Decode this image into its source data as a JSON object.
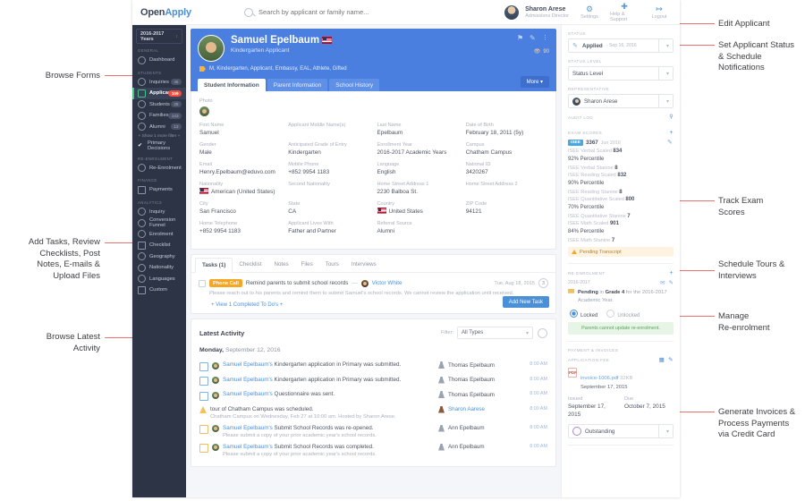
{
  "annotations": {
    "left": [
      {
        "text": "Browse Forms"
      },
      {
        "text": "Add Tasks, Review\nChecklists, Post\nNotes, E-mails &\nUpload Files"
      },
      {
        "text": "Browse Latest\nActivity"
      }
    ],
    "right": [
      {
        "text": "Edit Applicant"
      },
      {
        "text": "Set Applicant Status\n& Schedule\nNotifications"
      },
      {
        "text": "Track Exam\nScores"
      },
      {
        "text": "Schedule Tours &\nInterviews"
      },
      {
        "text": "Manage\nRe-enrolment"
      },
      {
        "text": "Generate Invoices &\nProcess Payments\nvia Credit Card"
      }
    ]
  },
  "topbar": {
    "logo_open": "Open",
    "logo_apply": "Apply",
    "search_placeholder": "Search by applicant or family name...",
    "user_name": "Sharon Arese",
    "user_role": "Admissions Director",
    "actions": [
      {
        "label": "Settings",
        "icon": "gear-icon"
      },
      {
        "label": "Help & Support",
        "icon": "help-icon"
      },
      {
        "label": "Logout",
        "icon": "logout-icon"
      }
    ]
  },
  "sidebar": {
    "year_selector": "2016-2017 Years",
    "groups": [
      {
        "title": "GENERAL",
        "items": [
          {
            "label": "Dashboard",
            "icon": "dashboard-icon",
            "badge": "",
            "active": false
          }
        ]
      },
      {
        "title": "STUDENTS",
        "items": [
          {
            "label": "Inquiries",
            "icon": "inquiries-icon",
            "badge": "45",
            "active": false
          },
          {
            "label": "Applicants",
            "icon": "applicants-icon",
            "badge": "109",
            "active": true
          },
          {
            "label": "Students",
            "icon": "students-icon",
            "badge": "28",
            "active": false
          },
          {
            "label": "Families",
            "icon": "families-icon",
            "badge": "143",
            "active": false
          },
          {
            "label": "Alumni",
            "icon": "alumni-icon",
            "badge": "13",
            "active": false
          }
        ],
        "show_more": "+ Show 1 more filter +",
        "extra": {
          "label": "Primary Decisions",
          "icon": "check-icon"
        }
      },
      {
        "title": "RE-ENROLMENT",
        "items": [
          {
            "label": "Re-Enrolment",
            "icon": "reenrolment-icon",
            "badge": "",
            "active": false
          }
        ]
      },
      {
        "title": "FINANCE",
        "items": [
          {
            "label": "Payments",
            "icon": "payments-icon",
            "badge": "",
            "active": false
          }
        ]
      },
      {
        "title": "ANALYTICS",
        "items": [
          {
            "label": "Inquiry",
            "icon": "inquiry-icon",
            "badge": "",
            "active": false
          },
          {
            "label": "Conversion Funnel",
            "icon": "funnel-icon",
            "badge": "",
            "active": false
          },
          {
            "label": "Enrolment",
            "icon": "enrolment-icon",
            "badge": "",
            "active": false
          },
          {
            "label": "Checklist",
            "icon": "checklist-icon",
            "badge": "",
            "active": false
          },
          {
            "label": "Geography",
            "icon": "geography-icon",
            "badge": "",
            "active": false
          },
          {
            "label": "Nationality",
            "icon": "nationality-icon",
            "badge": "",
            "active": false
          },
          {
            "label": "Languages",
            "icon": "languages-icon",
            "badge": "",
            "active": false
          },
          {
            "label": "Custom",
            "icon": "custom-icon",
            "badge": "",
            "active": false
          }
        ]
      }
    ]
  },
  "hero": {
    "student_name": "Samuel Epelbaum",
    "student_subtitle": "Kindergarten Applicant",
    "tags": "M, Kindergarten, Applicant, Embassy, EAL, Athlete, Gifted",
    "views_count": "90",
    "tabs": [
      {
        "label": "Student Information",
        "active": true
      },
      {
        "label": "Parent Information",
        "active": false
      },
      {
        "label": "School History",
        "active": false
      }
    ],
    "more_label": "More"
  },
  "info": {
    "photo_label": "Photo",
    "fields": [
      {
        "label": "First Name",
        "value": "Samuel"
      },
      {
        "label": "Applicant Middle Name(s)",
        "value": ""
      },
      {
        "label": "Last Name",
        "value": "Epelbaum"
      },
      {
        "label": "Date of Birth",
        "value": "February 18, 2011 (5y)"
      },
      {
        "label": "Gender",
        "value": "Male"
      },
      {
        "label": "Anticipated Grade of Entry",
        "value": "Kindergarten"
      },
      {
        "label": "Enrollment Year",
        "value": "2016-2017 Academic Years"
      },
      {
        "label": "Campus",
        "value": "Chatham Campus"
      },
      {
        "label": "Email",
        "value": "Henry.Epelbaum@eduvo.com"
      },
      {
        "label": "Mobile Phone",
        "value": "+852 9954 1183"
      },
      {
        "label": "Language",
        "value": "English"
      },
      {
        "label": "National ID",
        "value": "3420267"
      },
      {
        "label": "Nationality",
        "value": "American (United States)",
        "flag": true
      },
      {
        "label": "Second Nationality",
        "value": ""
      },
      {
        "label": "Home Street Address 1",
        "value": "2230 Balboa St."
      },
      {
        "label": "Home Street Address 2",
        "value": ""
      },
      {
        "label": "City",
        "value": "San Francisco"
      },
      {
        "label": "State",
        "value": "CA"
      },
      {
        "label": "Country",
        "value": "United States",
        "flag": true
      },
      {
        "label": "ZIP Code",
        "value": "94121"
      },
      {
        "label": "Home Telephone",
        "value": "+852 9954 1183"
      },
      {
        "label": "Applicant Lives With",
        "value": "Father and Partner"
      },
      {
        "label": "Referral Source",
        "value": "Alumni"
      },
      {
        "label": "",
        "value": ""
      }
    ]
  },
  "tasks": {
    "tabs": [
      {
        "label": "Tasks (1)",
        "active": true
      },
      {
        "label": "Checklist",
        "active": false
      },
      {
        "label": "Notes",
        "active": false
      },
      {
        "label": "Files",
        "active": false
      },
      {
        "label": "Tours",
        "active": false
      },
      {
        "label": "Interviews",
        "active": false
      }
    ],
    "pill": "Phone Call",
    "title": "Remind parents to submit school records",
    "assignee": "Victor White",
    "date": "Tue, Aug 18, 2015",
    "count": "3",
    "description": "Please reach out to his parents and remind them to submit Samuel's school records. We cannot review the application until received.",
    "view_completed": "+ View 1 Completed To Do's +",
    "add_button": "Add New Task"
  },
  "activity": {
    "title": "Latest Activity",
    "filter_label": "Filter:",
    "filter_value": "All Types",
    "date_day": "Monday,",
    "date_rest": " September 12, 2016",
    "rows": [
      {
        "icon": "form-icon",
        "link": "Samuel Epelbaum's",
        "text": " Kindergarten application in Primary was submitted.",
        "sub": "",
        "who": "Thomas Epelbaum",
        "who_link": false,
        "time": "8:00 AM"
      },
      {
        "icon": "form-icon",
        "link": "Samuel Epelbaum's",
        "text": " Kindergarten application in Primary was submitted.",
        "sub": "",
        "who": "Thomas Epelbaum",
        "who_link": false,
        "time": "8:00 AM"
      },
      {
        "icon": "mail-icon",
        "link": "Samuel Epelbaum's",
        "text": " Questionnaire was sent.",
        "sub": "",
        "who": "Thomas Epelbaum",
        "who_link": false,
        "time": "8:00 AM"
      },
      {
        "icon": "tour-icon",
        "link": "",
        "text": "tour of Chatham Campus was scheduled.",
        "sub": "Chatham Campus on Wednesday, Feb 27 at 10:00 am. Hosted by Sharon Arese.",
        "who": "Sharon Aarese",
        "who_link": true,
        "time": "8:00 AM"
      },
      {
        "icon": "note-icon",
        "link": "Samuel Epelbaum's",
        "text": " Submit School Records was re-opened.",
        "sub": "Please submit a copy of your prior academic year's school records.",
        "who": "Ann Epelbaum",
        "who_link": false,
        "time": "8:00 AM"
      },
      {
        "icon": "note-icon",
        "link": "Samuel Epelbaum's",
        "text": " Submit School Records was completed.",
        "sub": "Please submit a copy of your prior academic year's school records.",
        "who": "Ann Epelbaum",
        "who_link": false,
        "time": "8:00 AM"
      }
    ]
  },
  "rightpanel": {
    "status_header": "STATUS",
    "status_value": "Applied",
    "status_date": "- Sep 16, 2016",
    "status_level_header": "STATUS LEVEL",
    "status_level_value": "Status Level",
    "representative_header": "REPRESENTATIVE",
    "representative_value": "Sharon Arese",
    "audit_log_header": "AUDIT LOG",
    "exam_scores_header": "EXAM SCORES",
    "exam": {
      "tag": "ISEE",
      "score": "3367",
      "date": "Jun 2016",
      "lines": [
        {
          "label": "ISEE Verbal Scaled",
          "value": "834",
          "percentile": "92% Percentile"
        },
        {
          "label": "ISEE Verbal Stanine",
          "value": "8",
          "percentile": ""
        },
        {
          "label": "ISEE Reading Scaled",
          "value": "832",
          "percentile": "90% Percentile"
        },
        {
          "label": "ISEE Reading Stanine",
          "value": "8",
          "percentile": ""
        },
        {
          "label": "ISEE Quantitative Scaled",
          "value": "800",
          "percentile": "70% Percentile"
        },
        {
          "label": "ISEE Quantitative Stanine",
          "value": "7",
          "percentile": ""
        },
        {
          "label": "ISEE Math Scaled",
          "value": "901",
          "percentile": "84% Percentile"
        },
        {
          "label": "ISEE Math Stanine",
          "value": "7",
          "percentile": ""
        }
      ],
      "pending": "Pending Transcript"
    },
    "reenrolment_header": "RE-ENROLMENT",
    "reenrolment_year": "2016-2017",
    "reenrolment_status_bold": "Pending",
    "reenrolment_status_mid": " in ",
    "reenrolment_grade": "Grade 4",
    "reenrolment_tail": " for the 2016-2017 Academic Year.",
    "locked_label": "Locked",
    "unlocked_label": "Unlocked",
    "locked_note": "Parents cannot update re-enrolment.",
    "payment_header": "PAYMENT & INVOICES",
    "application_fee_header": "APPLICATION FEE",
    "invoice_name": "invoice-1006.pdf",
    "invoice_size": "32KB",
    "invoice_date": "September 17, 2015",
    "issued_label": "Issued",
    "issued_value": "September 17, 2015",
    "due_label": "Due",
    "due_value": "October 7, 2015",
    "outstanding_label": "Outstanding"
  }
}
